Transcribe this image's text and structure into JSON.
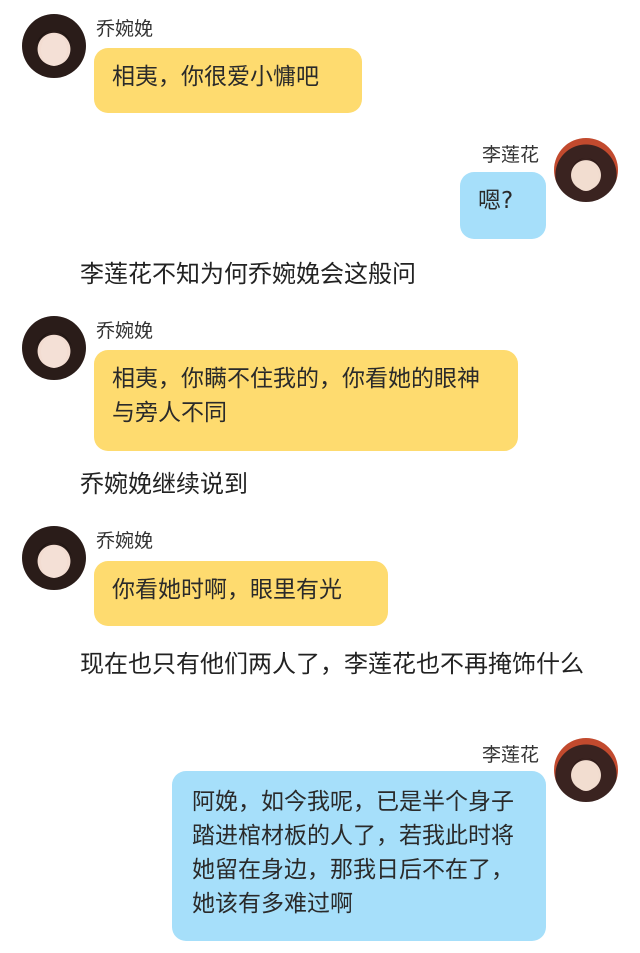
{
  "messages": [
    {
      "speaker": "乔婉娩",
      "text": "相夷，你很爱小慵吧",
      "side": "left"
    },
    {
      "speaker": "李莲花",
      "text": "嗯?",
      "side": "right"
    },
    {
      "speaker": "乔婉娩",
      "text": "相夷，你瞒不住我的，你看她的眼神与旁人不同",
      "side": "left"
    },
    {
      "speaker": "乔婉娩",
      "text": "你看她时啊，眼里有光",
      "side": "left"
    },
    {
      "speaker": "李莲花",
      "text": "阿娩，如今我呢，已是半个身子踏进棺材板的人了，若我此时将她留在身边，那我日后不在了，她该有多难过啊",
      "side": "right"
    }
  ],
  "narration": [
    "李莲花不知为何乔婉娩会这般问",
    "乔婉娩继续说到",
    "现在也只有他们两人了，李莲花也不再掩饰什么"
  ],
  "colors": {
    "left_bubble": "#fedb6f",
    "right_bubble": "#a6dffa",
    "background": "#ffffff"
  },
  "icons": {
    "left_avatar": "female-avatar-icon",
    "right_avatar": "male-avatar-icon"
  }
}
